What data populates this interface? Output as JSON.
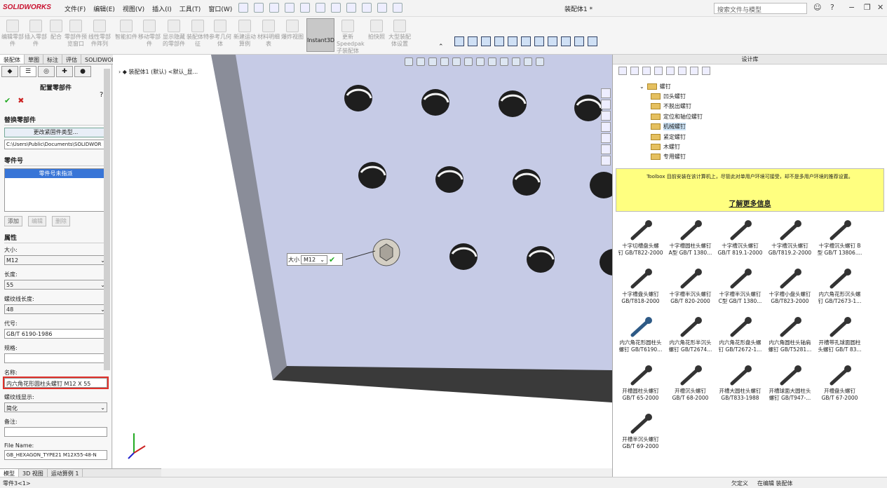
{
  "app": {
    "logo": "SOLIDWORKS",
    "document_title": "装配体1 *",
    "search_placeholder": "搜索文件与模型"
  },
  "menu": [
    "文件(F)",
    "编辑(E)",
    "视图(V)",
    "插入(I)",
    "工具(T)",
    "窗口(W)"
  ],
  "command_manager": {
    "items": [
      "编辑零部件",
      "插入零部件",
      "配合",
      "零部件预览窗口",
      "线性零部件阵列",
      "智能扣件",
      "移动零部件",
      "显示隐藏的零部件",
      "装配体特征",
      "参考几何体",
      "新建运动算例",
      "材料明细表",
      "爆炸视图",
      "Instant3D",
      "更新Speedpak子装配体",
      "拍快照",
      "大型装配体设置"
    ]
  },
  "tabs": [
    "装配体",
    "草图",
    "标注",
    "评估",
    "SOLIDWORKS 插件"
  ],
  "active_tab": "装配体",
  "property_manager": {
    "title": "配置零部件",
    "sections": {
      "replace": "替换零部件",
      "part_number": "零件号",
      "properties": "属性"
    },
    "change_type_button": "更改紧固件类型...",
    "path": "C:\\Users\\Public\\Documents\\SOLIDWOR",
    "part_number_item": "零件号未指派",
    "buttons": {
      "add": "添加",
      "edit": "编辑",
      "delete": "删除"
    },
    "fields": {
      "size": {
        "label": "大小:",
        "value": "M12"
      },
      "length": {
        "label": "长度:",
        "value": "55"
      },
      "thread_length": {
        "label": "螺纹线长度:",
        "value": "48"
      },
      "code": {
        "label": "代号:",
        "value": "GB/T 6190-1986"
      },
      "spec": {
        "label": "规格:",
        "value": ""
      },
      "name": {
        "label": "名称:",
        "value": "内六角花形圆柱头螺钉 M12 X 55"
      },
      "thread_display": {
        "label": "螺纹线显示:",
        "value": "简化"
      },
      "note": {
        "label": "备注:",
        "value": ""
      },
      "file_name": {
        "label": "File Name:",
        "value": "GB_HEXAGON_TYPE21 M12X55-48-N"
      }
    }
  },
  "viewport": {
    "tree_node": "装配体1 (默认) <默认_显...",
    "size_popup": {
      "label": "大小",
      "value": "M12"
    }
  },
  "design_library": {
    "title": "设计库",
    "folders": [
      {
        "label": "螺钉",
        "child": false,
        "selected": false
      },
      {
        "label": "凹头螺钉",
        "child": true,
        "selected": false
      },
      {
        "label": "不脱出螺钉",
        "child": true,
        "selected": false
      },
      {
        "label": "定位和轴位螺钉",
        "child": true,
        "selected": false
      },
      {
        "label": "机械螺钉",
        "child": true,
        "selected": true
      },
      {
        "label": "紧定螺钉",
        "child": true,
        "selected": false
      },
      {
        "label": "木螺钉",
        "child": true,
        "selected": false
      },
      {
        "label": "专用螺钉",
        "child": true,
        "selected": false
      }
    ],
    "notice": "Toolbox 目前安装在该计算机上，尽管此对单用户环境可接受，却不是多用户环境的推荐设置。",
    "notice_link": "了解更多信息",
    "items": [
      [
        "十字切槽盘头螺",
        "钉 GB/T822-2000"
      ],
      [
        "十字槽圆柱头螺钉",
        "A型 GB/T 1380..."
      ],
      [
        "十字槽沉头螺钉",
        "GB/T 819.1-2000"
      ],
      [
        "十字槽沉头螺钉",
        "GB/T819.2-2000"
      ],
      [
        "十字槽沉头螺钉 B",
        "型 GB/T 13806...."
      ],
      [
        "十字槽盘头螺钉",
        "GB/T818-2000"
      ],
      [
        "十字槽半沉头螺钉",
        "GB/T 820-2000"
      ],
      [
        "十字槽半沉头螺钉",
        "C型 GB/T 1380..."
      ],
      [
        "十字槽小盘头螺钉",
        "GB/T823-2000"
      ],
      [
        "内六角花形沉头螺",
        "钉 GB/T2673-1..."
      ],
      [
        "内六角花形圆柱头",
        "螺钉 GB/T6190..."
      ],
      [
        "内六角花形半沉头",
        "螺钉 GB/T2674..."
      ],
      [
        "内六角花形盘头螺",
        "钉 GB/T2672-1..."
      ],
      [
        "内六角圆柱头轴肩",
        "螺钉 GB/T5281..."
      ],
      [
        "开槽带孔球面圆柱",
        "头螺钉 GB/T 83..."
      ],
      [
        "开槽圆柱头螺钉",
        "GB/T 65-2000"
      ],
      [
        "开槽沉头螺钉",
        "GB/T 68-2000"
      ],
      [
        "开槽大圆柱头螺钉",
        "GB/T833-1988"
      ],
      [
        "开槽球面大圆柱头",
        "螺钉 GB/T947-..."
      ],
      [
        "开槽盘头螺钉",
        "GB/T 67-2000"
      ],
      [
        "开槽半沉头螺钉",
        "GB/T 69-2000"
      ]
    ]
  },
  "bottom_tabs": [
    "模型",
    "3D 视图",
    "运动算例 1"
  ],
  "active_bottom_tab": "模型",
  "status": {
    "left": "零件3<1>",
    "under_defined": "欠定义",
    "editing": "在编辑 装配体"
  },
  "colors": {
    "plate": "#c6cbe6",
    "plate_edge": "#4a4a4a",
    "notice": "#ffff80",
    "accent": "#3875d7",
    "highlight": "#e0302a"
  }
}
